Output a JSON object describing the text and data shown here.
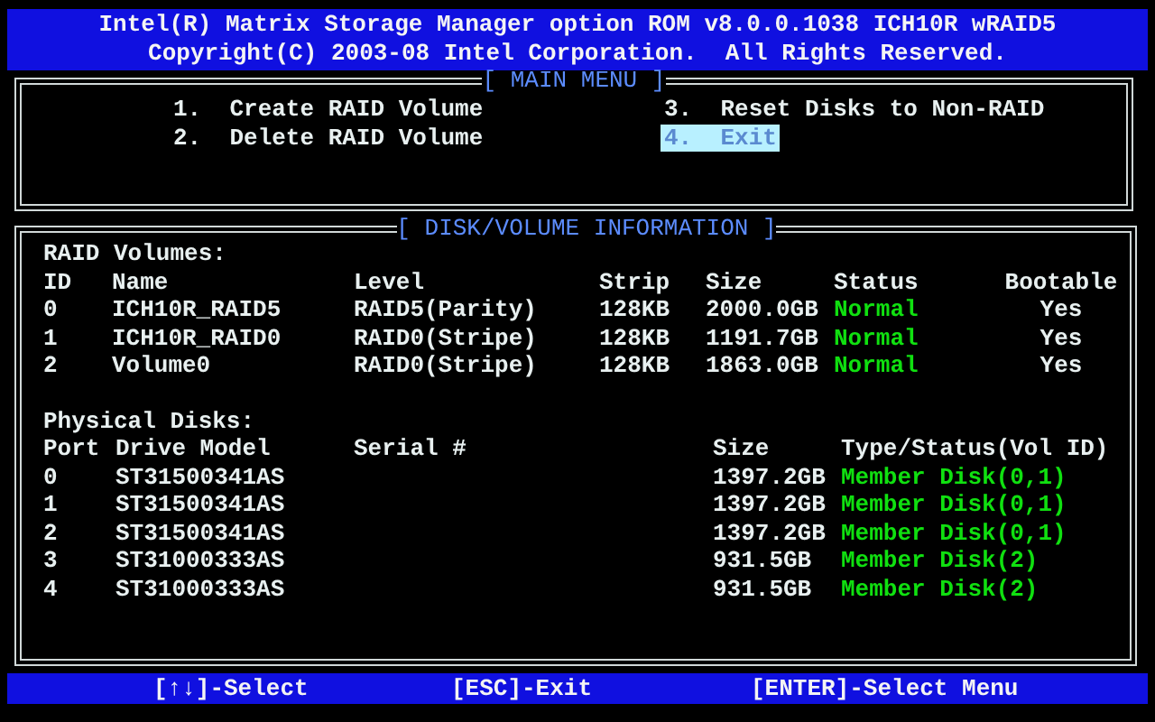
{
  "header": {
    "title": "Intel(R) Matrix Storage Manager option ROM v8.0.0.1038 ICH10R wRAID5",
    "copyright": "Copyright(C) 2003-08 Intel Corporation.  All Rights Reserved."
  },
  "main_menu": {
    "title": "[ MAIN MENU ]",
    "items": [
      {
        "number": "1.",
        "label": "Create RAID Volume",
        "selected": false
      },
      {
        "number": "2.",
        "label": "Delete RAID Volume",
        "selected": false
      },
      {
        "number": "3.",
        "label": "Reset Disks to Non-RAID",
        "selected": false
      },
      {
        "number": "4.",
        "label": "Exit",
        "selected": true
      }
    ]
  },
  "disk_info": {
    "title": "[ DISK/VOLUME INFORMATION ]",
    "raid_volumes": {
      "heading": "RAID Volumes:",
      "columns": [
        "ID",
        "Name",
        "Level",
        "Strip",
        "Size",
        "Status",
        "Bootable"
      ],
      "rows": [
        [
          "0",
          "ICH10R_RAID5",
          "RAID5(Parity)",
          "128KB",
          "2000.0GB",
          "Normal",
          "Yes"
        ],
        [
          "1",
          "ICH10R_RAID0",
          "RAID0(Stripe)",
          "128KB",
          "1191.7GB",
          "Normal",
          "Yes"
        ],
        [
          "2",
          "Volume0",
          "RAID0(Stripe)",
          "128KB",
          "1863.0GB",
          "Normal",
          "Yes"
        ]
      ]
    },
    "physical_disks": {
      "heading": "Physical Disks:",
      "columns": [
        "Port",
        "Drive Model",
        "Serial #",
        "Size",
        "Type/Status(Vol ID)"
      ],
      "rows": [
        [
          "0",
          "ST31500341AS",
          "",
          "1397.2GB",
          "Member Disk(0,1)"
        ],
        [
          "1",
          "ST31500341AS",
          "",
          "1397.2GB",
          "Member Disk(0,1)"
        ],
        [
          "2",
          "ST31500341AS",
          "",
          "1397.2GB",
          "Member Disk(0,1)"
        ],
        [
          "3",
          "ST31000333AS",
          "",
          "931.5GB",
          "Member Disk(2)"
        ],
        [
          "4",
          "ST31000333AS",
          "",
          "931.5GB",
          "Member Disk(2)"
        ]
      ]
    }
  },
  "footer": [
    "[↑↓]-Select",
    "[ESC]-Exit",
    "[ENTER]-Select Menu"
  ]
}
